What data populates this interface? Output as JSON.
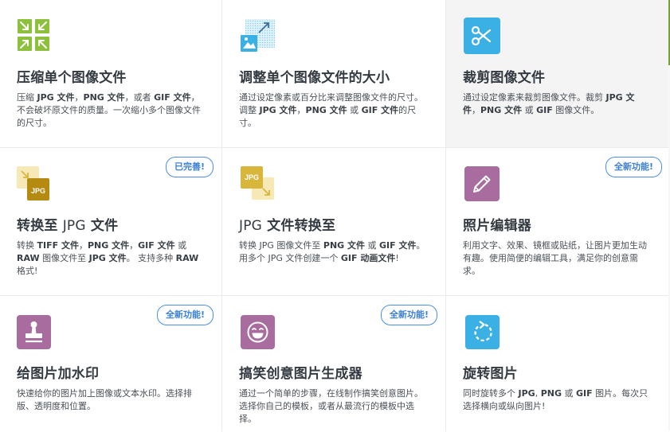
{
  "colors": {
    "green": "#8dc03c",
    "blue": "#3ab0e4",
    "yellow": "#d8b53b",
    "purple": "#a86c9e",
    "badge": "#4a90e2"
  },
  "cards": [
    {
      "id": "compress",
      "icon": "compress-arrows-icon",
      "title": "压缩单个图像文件",
      "desc": [
        "压缩 ",
        {
          "b": "JPG 文件"
        },
        "，",
        {
          "b": "PNG 文件"
        },
        "，或者 ",
        {
          "b": "GIF 文件"
        },
        "，不会破坏原文件的质量。一次缩小多个图像文件的尺寸。"
      ]
    },
    {
      "id": "resize",
      "icon": "resize-image-icon",
      "title": "调整单个图像文件的大小",
      "desc": [
        "通过设定像素或百分比来调整图像文件的尺寸。 调整 ",
        {
          "b": "JPG 文件"
        },
        "，",
        {
          "b": "PNG 文件"
        },
        " 或 ",
        {
          "b": "GIF 文件"
        },
        "的尺寸。"
      ]
    },
    {
      "id": "crop",
      "icon": "scissors-icon",
      "title": "裁剪图像文件",
      "desc": [
        "通过设定像素来裁剪图像文件。裁剪 ",
        {
          "b": "JPG 文件"
        },
        "，",
        {
          "b": "PNG 文件"
        },
        " 或 ",
        {
          "b": "GIF"
        },
        " 图像文件。"
      ]
    },
    {
      "id": "to-jpg",
      "icon": "convert-to-jpg-icon",
      "icon_text": "JPG",
      "badge": "已完善!",
      "title_parts": [
        {
          "t": "转换至 "
        },
        {
          "t": "JPG",
          "thin": true
        },
        {
          "t": " 文件"
        }
      ],
      "desc": [
        "转换 ",
        {
          "b": "TIFF 文件"
        },
        "，",
        {
          "b": "PNG 文件"
        },
        "，",
        {
          "b": "GIF 文件"
        },
        " 或 ",
        {
          "b": "RAW"
        },
        " 图像文件至 ",
        {
          "b": "JPG 文件"
        },
        "。 支持多种 ",
        {
          "b": "RAW"
        },
        " 格式!"
      ]
    },
    {
      "id": "from-jpg",
      "icon": "convert-from-jpg-icon",
      "icon_text": "JPG",
      "title_parts": [
        {
          "t": "JPG",
          "thin": true
        },
        {
          "t": " 文件转换至"
        }
      ],
      "desc": [
        "转换 JPG 图像文件至 ",
        {
          "b": "PNG 文件"
        },
        " 或 ",
        {
          "b": "GIF 文件"
        },
        "。用多个 JPG 文件创建一个 ",
        {
          "b": "GIF 动画文件"
        },
        "!"
      ]
    },
    {
      "id": "editor",
      "icon": "pencil-icon",
      "badge": "全新功能!",
      "title": "照片编辑器",
      "desc": [
        "利用文字、效果、镜框或贴纸，让图片更加生动有趣。使用简便的编辑工具，满足你的创意需求。"
      ]
    },
    {
      "id": "watermark",
      "icon": "stamp-icon",
      "badge": "全新功能!",
      "title": "给图片加水印",
      "desc": [
        "快速给你的图片加上图像或文本水印。选择排版、透明度和位置。"
      ]
    },
    {
      "id": "meme",
      "icon": "laughing-face-icon",
      "badge": "全新功能!",
      "title": "搞笑创意图片生成器",
      "desc": [
        "通过一个简单的步骤，在线制作搞笑创意图片。选择你自己的模板，或者从最流行的模板中选择。"
      ]
    },
    {
      "id": "rotate",
      "icon": "rotate-icon",
      "title": "旋转图片",
      "desc": [
        "同时旋转多个 ",
        {
          "b": "JPG"
        },
        ", ",
        {
          "b": "PNG"
        },
        " 或 ",
        {
          "b": "GIF"
        },
        " 图片。每次只选择横向或纵向图片!"
      ]
    }
  ]
}
